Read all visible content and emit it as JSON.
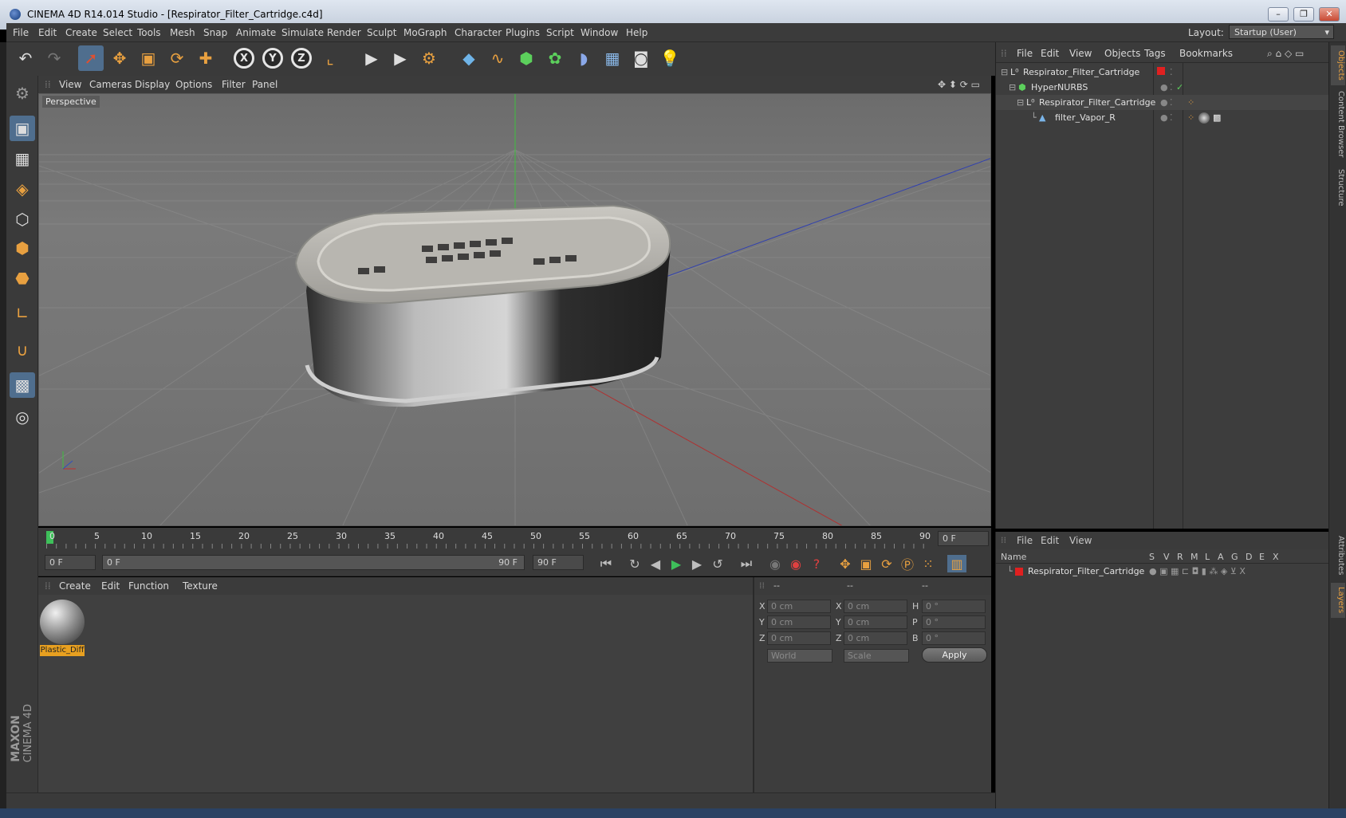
{
  "window": {
    "title": "CINEMA 4D R14.014 Studio - [Respirator_Filter_Cartridge.c4d]",
    "controls": [
      "–",
      "❐",
      "✕"
    ]
  },
  "menu": {
    "items": [
      "File",
      "Edit",
      "Create",
      "Select",
      "Tools",
      "Mesh",
      "Snap",
      "Animate",
      "Simulate",
      "Render",
      "Sculpt",
      "MoGraph",
      "Character",
      "Plugins",
      "Script",
      "Window",
      "Help"
    ],
    "layout_label": "Layout:",
    "layout_value": "Startup (User)"
  },
  "toolbar": {
    "axes": [
      "X",
      "Y",
      "Z"
    ]
  },
  "viewport": {
    "menu": [
      "View",
      "Cameras",
      "Display",
      "Options",
      "Filter",
      "Panel"
    ],
    "label": "Perspective"
  },
  "timeline": {
    "ticks": [
      "0",
      "5",
      "10",
      "15",
      "20",
      "25",
      "30",
      "35",
      "40",
      "45",
      "50",
      "55",
      "60",
      "65",
      "70",
      "75",
      "80",
      "85",
      "90"
    ],
    "current_frame": "0 F",
    "start_frame": "0 F",
    "range_start": "0 F",
    "range_end": "90 F",
    "end_frame": "90 F"
  },
  "materials": {
    "menu": [
      "Create",
      "Edit",
      "Function",
      "Texture"
    ],
    "items": [
      {
        "name": "Plastic_Diff"
      }
    ]
  },
  "coordinates": {
    "headers": [
      "--",
      "--",
      "--"
    ],
    "rows": [
      {
        "a": "X",
        "av": "0 cm",
        "b": "X",
        "bv": "0 cm",
        "c": "H",
        "cv": "0 °"
      },
      {
        "a": "Y",
        "av": "0 cm",
        "b": "Y",
        "bv": "0 cm",
        "c": "P",
        "cv": "0 °"
      },
      {
        "a": "Z",
        "av": "0 cm",
        "b": "Z",
        "bv": "0 cm",
        "c": "B",
        "cv": "0 °"
      }
    ],
    "mode1": "World",
    "mode2": "Scale",
    "apply": "Apply"
  },
  "objects": {
    "menu": [
      "File",
      "Edit",
      "View",
      "Objects",
      "Tags",
      "Bookmarks"
    ],
    "rows": [
      "Respirator_Filter_Cartridge",
      "HyperNURBS",
      "Respirator_Filter_Cartridge",
      "filter_Vapor_R"
    ]
  },
  "layers": {
    "menu": [
      "File",
      "Edit",
      "View"
    ],
    "name_header": "Name",
    "cols": [
      "S",
      "V",
      "R",
      "M",
      "L",
      "A",
      "G",
      "D",
      "E",
      "X"
    ],
    "row": "Respirator_Filter_Cartridge"
  },
  "side_tabs": [
    "Objects",
    "Content Browser",
    "Structure",
    "Attributes",
    "Layers"
  ],
  "brand": {
    "maxon": "MAXON",
    "cinema": "CINEMA 4D"
  }
}
